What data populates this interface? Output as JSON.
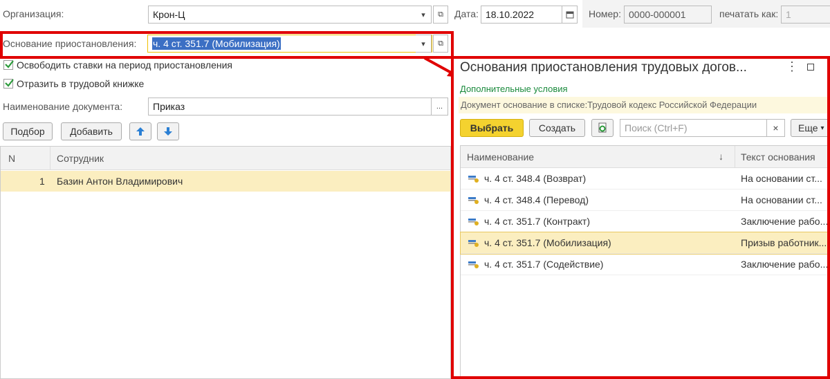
{
  "header": {
    "org_label": "Организация:",
    "org_value": "Крон-Ц",
    "date_label": "Дата:",
    "date_value": "18.10.2022",
    "number_label": "Номер:",
    "number_value": "0000-000001",
    "print_label": "печатать как:",
    "print_value": "1"
  },
  "basis": {
    "label": "Основание приостановления:",
    "value": "ч. 4 ст. 351.7 (Мобилизация)"
  },
  "checkboxes": {
    "free_rates": "Освободить ставки на период приостановления",
    "workbook": "Отразить в трудовой книжке"
  },
  "docname": {
    "label": "Наименование документа:",
    "value": "Приказ",
    "more": "..."
  },
  "toolbar": {
    "select_label": "Подбор",
    "add_label": "Добавить"
  },
  "table": {
    "col_n": "N",
    "col_employee": "Сотрудник",
    "rows": [
      {
        "n": "1",
        "employee": "Базин Антон Владимирович"
      }
    ]
  },
  "popup": {
    "title": "Основания приостановления трудовых догов...",
    "link": "Дополнительные условия",
    "note": "Документ основание в списке:Трудовой кодекс Российской Федерации",
    "choose_label": "Выбрать",
    "create_label": "Создать",
    "search_placeholder": "Поиск (Ctrl+F)",
    "clear": "×",
    "more_label": "Еще",
    "col_name": "Наименование",
    "col_text": "Текст основания",
    "sort_arrow": "↓",
    "rows": [
      {
        "name": "ч. 4 ст. 348.4 (Возврат)",
        "text": "На основании ст..."
      },
      {
        "name": "ч. 4 ст. 348.4 (Перевод)",
        "text": "На основании ст..."
      },
      {
        "name": "ч. 4 ст. 351.7 (Контракт)",
        "text": "Заключение рабо..."
      },
      {
        "name": "ч. 4 ст. 351.7 (Мобилизация)",
        "text": "Призыв работник..."
      },
      {
        "name": "ч. 4 ст. 351.7 (Содействие)",
        "text": "Заключение рабо..."
      }
    ],
    "selected_index": 3
  },
  "colors": {
    "highlight_red": "#e00000",
    "selected_row": "#fbeec0",
    "choose_button": "#f4d22f",
    "link_green": "#1a8a3c",
    "selection_blue": "#3b6fc4"
  }
}
